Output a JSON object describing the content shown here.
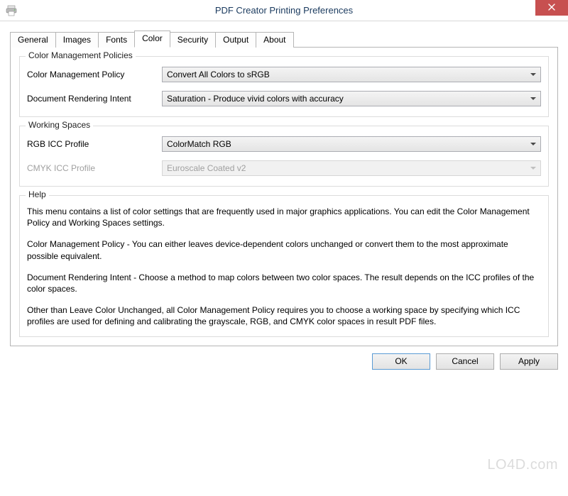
{
  "window": {
    "title": "PDF Creator Printing Preferences"
  },
  "tabs": [
    {
      "label": "General"
    },
    {
      "label": "Images"
    },
    {
      "label": "Fonts"
    },
    {
      "label": "Color",
      "active": true
    },
    {
      "label": "Security"
    },
    {
      "label": "Output"
    },
    {
      "label": "About"
    }
  ],
  "group_color_management": {
    "legend": "Color Management Policies",
    "policy_label": "Color Management Policy",
    "policy_value": "Convert All Colors to sRGB",
    "intent_label": "Document Rendering Intent",
    "intent_value": "Saturation - Produce vivid colors with accuracy"
  },
  "group_working_spaces": {
    "legend": "Working Spaces",
    "rgb_label": "RGB ICC Profile",
    "rgb_value": "ColorMatch RGB",
    "cmyk_label": "CMYK ICC Profile",
    "cmyk_value": "Euroscale Coated v2",
    "cmyk_disabled": true
  },
  "group_help": {
    "legend": "Help",
    "p1": "This menu contains a list of color settings that are frequently used in major graphics applications. You can edit the Color Management Policy and Working Spaces settings.",
    "p2": "Color Management Policy - You can either leaves device-dependent colors unchanged or convert them to the most approximate possible equivalent.",
    "p3": "Document Rendering Intent - Choose a method to map colors between two color spaces. The result depends on the ICC profiles of the color spaces.",
    "p4": "Other than Leave Color Unchanged, all Color Management Policy requires you to choose a working space by specifying which ICC profiles are used for defining and calibrating the grayscale, RGB, and CMYK color spaces in result PDF files."
  },
  "buttons": {
    "ok": "OK",
    "cancel": "Cancel",
    "apply": "Apply"
  },
  "watermark": "LO4D.com"
}
